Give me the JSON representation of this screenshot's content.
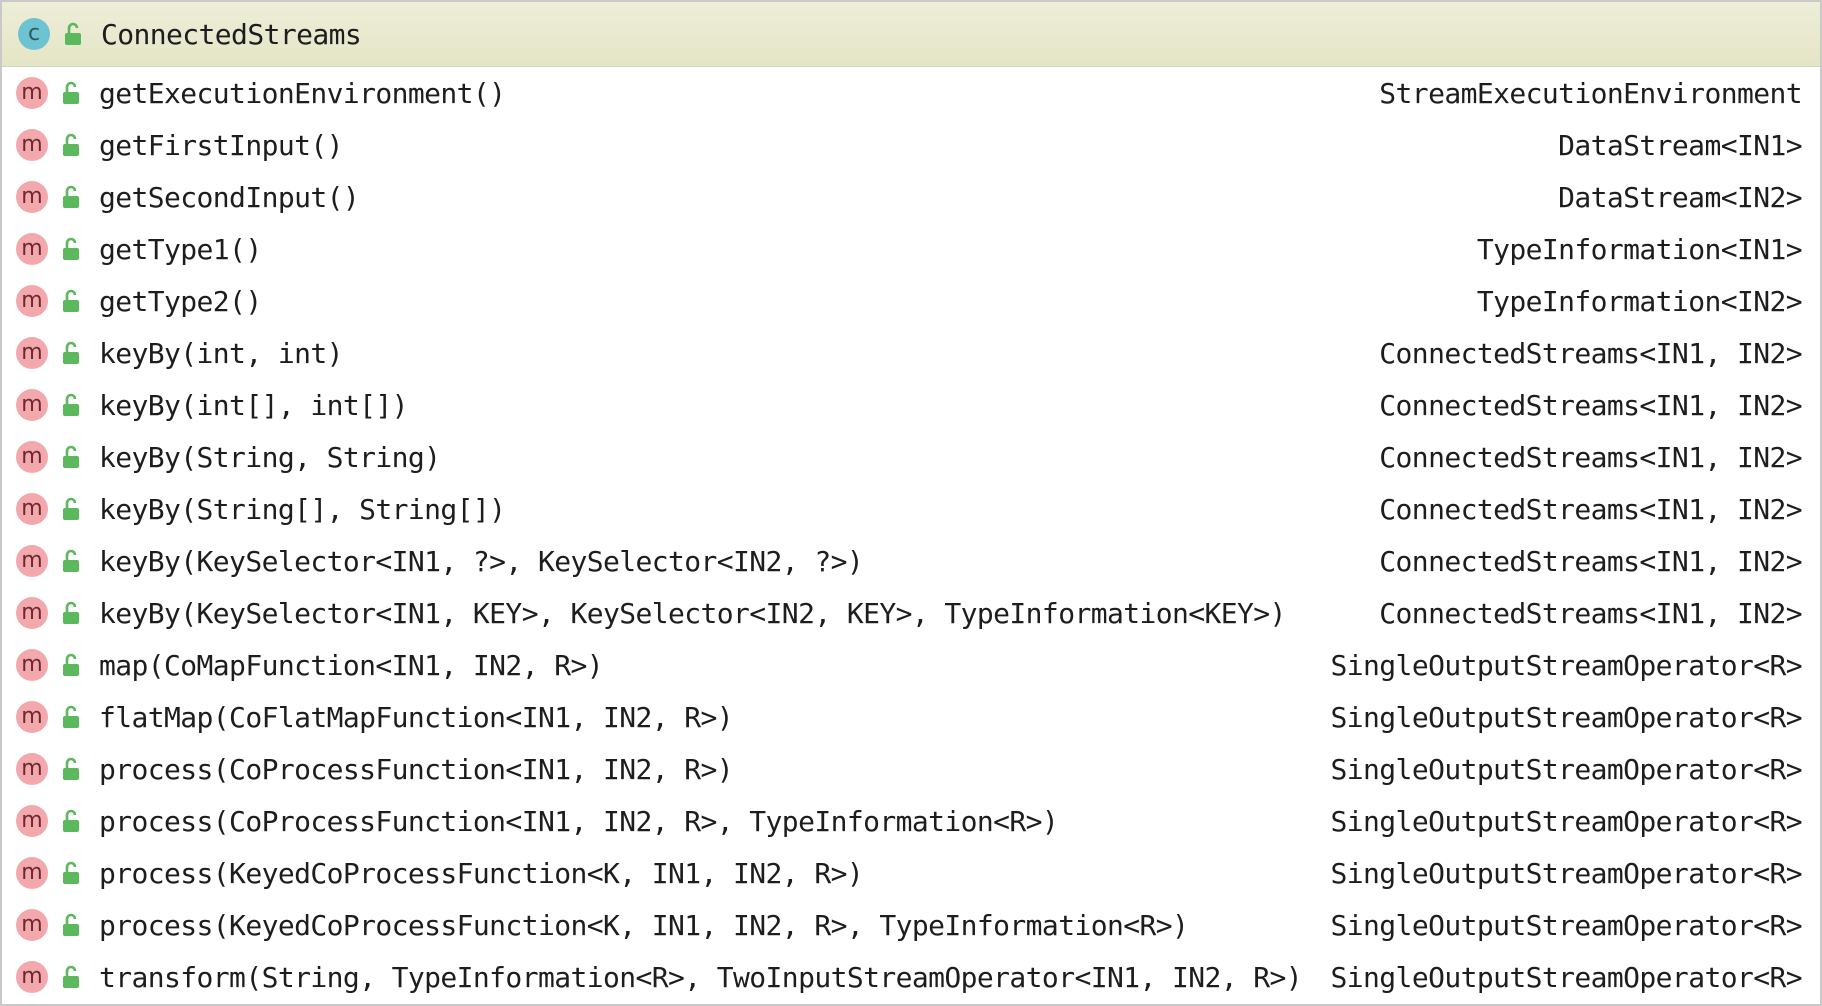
{
  "structure": {
    "class_kind": "c",
    "class_name": "ConnectedStreams",
    "method_kind": "m",
    "methods": [
      {
        "signature": "getExecutionEnvironment()",
        "return_type": "StreamExecutionEnvironment"
      },
      {
        "signature": "getFirstInput()",
        "return_type": "DataStream<IN1>"
      },
      {
        "signature": "getSecondInput()",
        "return_type": "DataStream<IN2>"
      },
      {
        "signature": "getType1()",
        "return_type": "TypeInformation<IN1>"
      },
      {
        "signature": "getType2()",
        "return_type": "TypeInformation<IN2>"
      },
      {
        "signature": "keyBy(int, int)",
        "return_type": "ConnectedStreams<IN1, IN2>"
      },
      {
        "signature": "keyBy(int[], int[])",
        "return_type": "ConnectedStreams<IN1, IN2>"
      },
      {
        "signature": "keyBy(String, String)",
        "return_type": "ConnectedStreams<IN1, IN2>"
      },
      {
        "signature": "keyBy(String[], String[])",
        "return_type": "ConnectedStreams<IN1, IN2>"
      },
      {
        "signature": "keyBy(KeySelector<IN1, ?>, KeySelector<IN2, ?>)",
        "return_type": "ConnectedStreams<IN1, IN2>"
      },
      {
        "signature": "keyBy(KeySelector<IN1, KEY>, KeySelector<IN2, KEY>, TypeInformation<KEY>)",
        "return_type": "ConnectedStreams<IN1, IN2>"
      },
      {
        "signature": "map(CoMapFunction<IN1, IN2, R>)",
        "return_type": "SingleOutputStreamOperator<R>"
      },
      {
        "signature": "flatMap(CoFlatMapFunction<IN1, IN2, R>)",
        "return_type": "SingleOutputStreamOperator<R>"
      },
      {
        "signature": "process(CoProcessFunction<IN1, IN2, R>)",
        "return_type": "SingleOutputStreamOperator<R>"
      },
      {
        "signature": "process(CoProcessFunction<IN1, IN2, R>, TypeInformation<R>)",
        "return_type": "SingleOutputStreamOperator<R>"
      },
      {
        "signature": "process(KeyedCoProcessFunction<K, IN1, IN2, R>)",
        "return_type": "SingleOutputStreamOperator<R>"
      },
      {
        "signature": "process(KeyedCoProcessFunction<K, IN1, IN2, R>, TypeInformation<R>)",
        "return_type": "SingleOutputStreamOperator<R>"
      },
      {
        "signature": "transform(String, TypeInformation<R>, TwoInputStreamOperator<IN1, IN2, R>)",
        "return_type": "SingleOutputStreamOperator<R>"
      }
    ]
  },
  "icons": {
    "class": "class-icon",
    "method": "method-icon",
    "public": "public-lock-icon"
  },
  "colors": {
    "header_background": "#e6e7c9",
    "class_badge": "#6ec3d2",
    "method_badge": "#f3a8ad",
    "lock": "#5cb85c"
  }
}
